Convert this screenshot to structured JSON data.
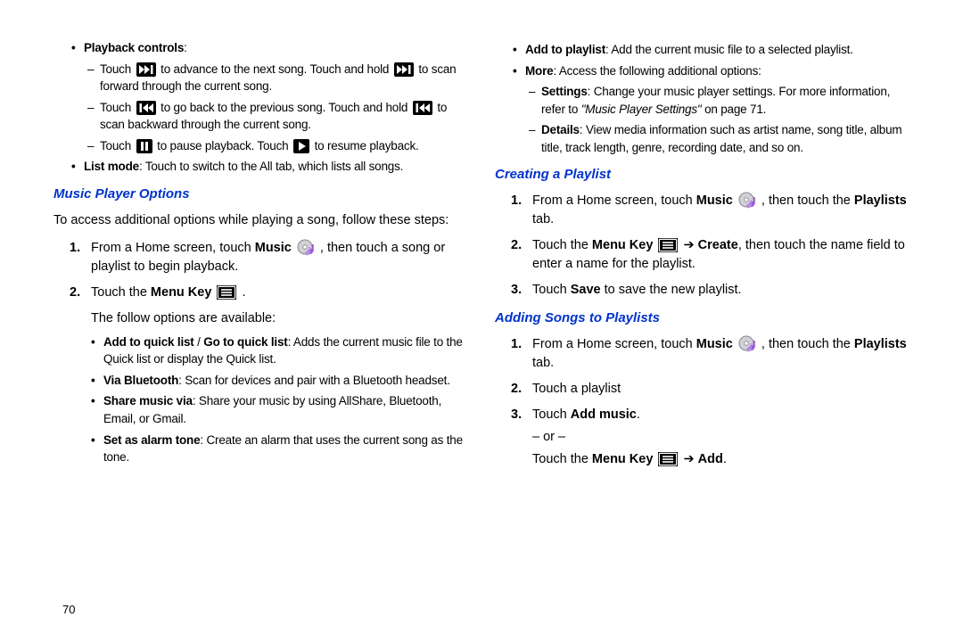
{
  "left": {
    "playbackControlsLabel": "Playback controls",
    "pc1a": "Touch ",
    "pc1b": " to advance to the next song. Touch and hold ",
    "pc1c": " to scan forward through the current song.",
    "pc2a": "Touch ",
    "pc2b": " to go back to the previous song. Touch and hold ",
    "pc2c": " to scan backward through the current song.",
    "pc3a": "Touch ",
    "pc3b": " to pause playback. Touch ",
    "pc3c": " to resume playback.",
    "listModeBold": "List mode",
    "listModeRest": ": Touch to switch to the All tab, which lists all songs.",
    "heading1": "Music Player Options",
    "intro": "To access additional options while playing a song, follow these steps:",
    "step1a": "From a Home screen, touch ",
    "step1music": "Music",
    "step1b": " , then touch a song or playlist to begin playback.",
    "step2a": "Touch the ",
    "step2menukey": "Menu Key",
    "step2b": " .",
    "availIntro": "The follow options are available:",
    "opt1bold": "Add to quick list",
    "opt1sep": " / ",
    "opt1bold2": "Go to quick list",
    "opt1rest": ": Adds the current music file to the Quick list or display the Quick list.",
    "opt2bold": "Via Bluetooth",
    "opt2rest": ": Scan for devices and pair with a Bluetooth headset.",
    "opt3bold": "Share music via",
    "opt3rest": ": Share your music by using AllShare, Bluetooth, Email, or Gmail.",
    "opt4bold": "Set as alarm tone",
    "opt4rest": ": Create an alarm that uses the current song as the tone."
  },
  "right": {
    "addToPlaylistBold": "Add to playlist",
    "addToPlaylistRest": ": Add the current music file to a selected playlist.",
    "moreBold": "More",
    "moreRest": ": Access the following additional options:",
    "settingsBold": "Settings",
    "settingsRest1": ": Change your music player settings. For more information, refer to ",
    "settingsItalic": "\"Music Player Settings\"",
    "settingsRest2": "  on page 71.",
    "detailsBold": "Details",
    "detailsRest": ": View media information such as artist name, song title, album title, track length, genre, recording date, and so on.",
    "heading2": "Creating a Playlist",
    "cp1a": "From a Home screen, touch ",
    "cp1music": "Music",
    "cp1b": " , then touch the ",
    "cp1playlists": "Playlists",
    "cp1c": " tab.",
    "cp2a": "Touch the ",
    "cp2menukey": "Menu Key",
    "cp2arrow": " ➔ ",
    "cp2create": "Create",
    "cp2b": ", then touch the name field to enter a name for the playlist.",
    "cp3a": "Touch ",
    "cp3save": "Save",
    "cp3b": " to save the new playlist.",
    "heading3": "Adding Songs to Playlists",
    "as1a": "From a Home screen, touch ",
    "as1music": "Music",
    "as1b": " , then touch the ",
    "as1playlists": "Playlists",
    "as1c": " tab.",
    "as2": "Touch a playlist",
    "as3a": "Touch ",
    "as3addmusic": "Add music",
    "as3b": ".",
    "or": "– or –",
    "as3c": "Touch the ",
    "as3menukey": "Menu Key",
    "as3arrow": "  ➔ ",
    "as3add": "Add",
    "as3d": "."
  },
  "pageNumber": "70"
}
